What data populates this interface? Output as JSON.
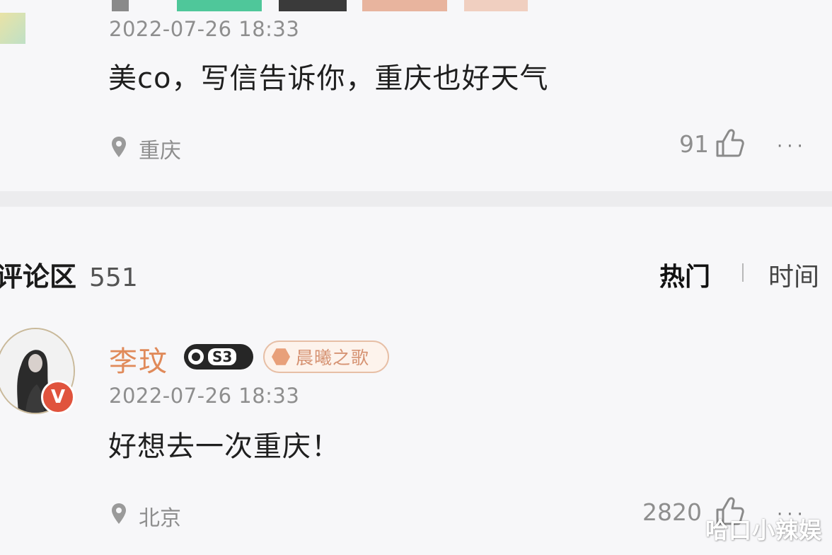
{
  "colors": {
    "background": "#f7f7f9",
    "divider": "#ececee",
    "username": "#e08a5a",
    "verified_badge": "#e0533d",
    "secondary_text": "#8e8e8e"
  },
  "prev_comment": {
    "timestamp": "2022-07-26 18:33",
    "text": "美co，写信告诉你，重庆也好天气",
    "location_icon": "location-pin-icon",
    "location": "重庆",
    "like_count": "91",
    "like_icon": "thumbs-up-icon",
    "more_label": "···"
  },
  "comments_header": {
    "title": "评论区",
    "count": "551",
    "tab_hot": "热门",
    "tab_time": "时间"
  },
  "comment": {
    "username": "李玟",
    "level_badge": "S3",
    "fan_badge": "晨曦之歌",
    "verified_label": "V",
    "timestamp": "2022-07-26 18:33",
    "text": "好想去一次重庆！",
    "location_icon": "location-pin-icon",
    "location": "北京",
    "like_count": "2820",
    "like_icon": "thumbs-up-icon",
    "more_label": "···"
  },
  "watermark": "哈口小辣娱"
}
